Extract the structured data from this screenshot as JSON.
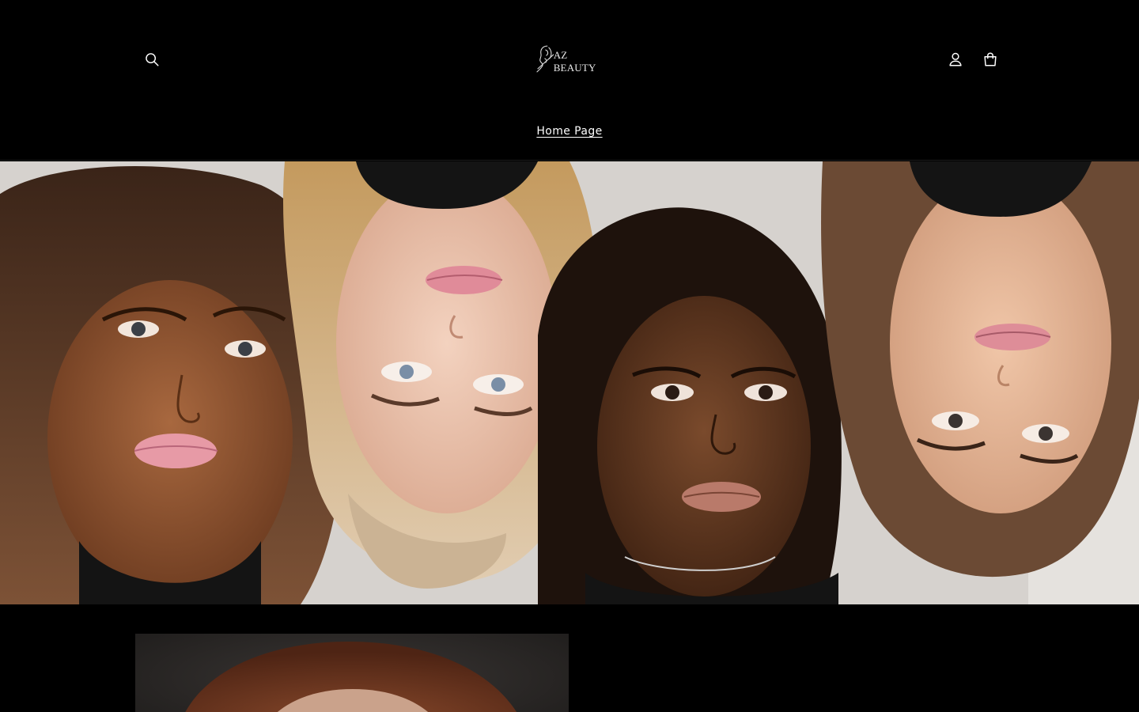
{
  "header": {
    "search_icon": "search-icon",
    "account_icon": "account-icon",
    "cart_icon": "cart-icon",
    "logo_text": "AZ BEAUTY",
    "logo_alt": "AZ Beauty"
  },
  "nav": {
    "items": [
      {
        "label": "Home Page",
        "active": true
      }
    ]
  },
  "hero": {
    "alt": "Four women lying with heads together, alternating upright and upside-down"
  },
  "feature": {
    "alt": "Portrait of a woman with auburn hair"
  },
  "colors": {
    "background": "#000000",
    "text": "#ffffff"
  }
}
